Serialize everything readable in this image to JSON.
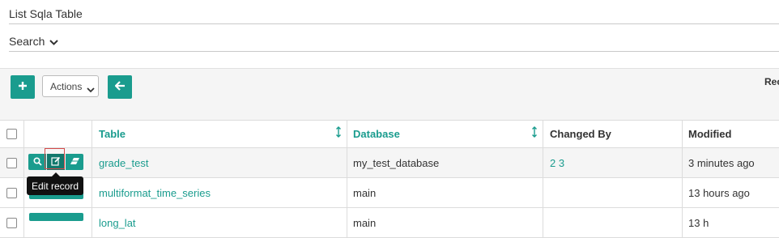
{
  "header": {
    "title": "List Sqla Table"
  },
  "search": {
    "label": "Search"
  },
  "toolbar": {
    "actions_label": "Actions",
    "record_label": "Rec"
  },
  "columns": {
    "table": "Table",
    "database": "Database",
    "changed_by": "Changed By",
    "modified": "Modified"
  },
  "rows": [
    {
      "table": "grade_test",
      "database": "my_test_database",
      "changed_by": "2 3",
      "modified": "3 minutes ago"
    },
    {
      "table": "multiformat_time_series",
      "database": "main",
      "changed_by": "",
      "modified": "13 hours ago"
    },
    {
      "table": "long_lat",
      "database": "main",
      "changed_by": "",
      "modified": "13 h"
    }
  ],
  "tooltip": {
    "text": "Edit record"
  },
  "icons": {
    "add": "plus-icon",
    "back": "arrow-left-icon",
    "show": "search-icon",
    "edit": "edit-icon",
    "delete": "eraser-icon",
    "sort": "sort-icon",
    "search_toggle": "chevron-down-icon"
  },
  "colors": {
    "accent": "#1a9c8e",
    "accent_dark": "#11786c",
    "tooltip_bg": "#111111"
  }
}
